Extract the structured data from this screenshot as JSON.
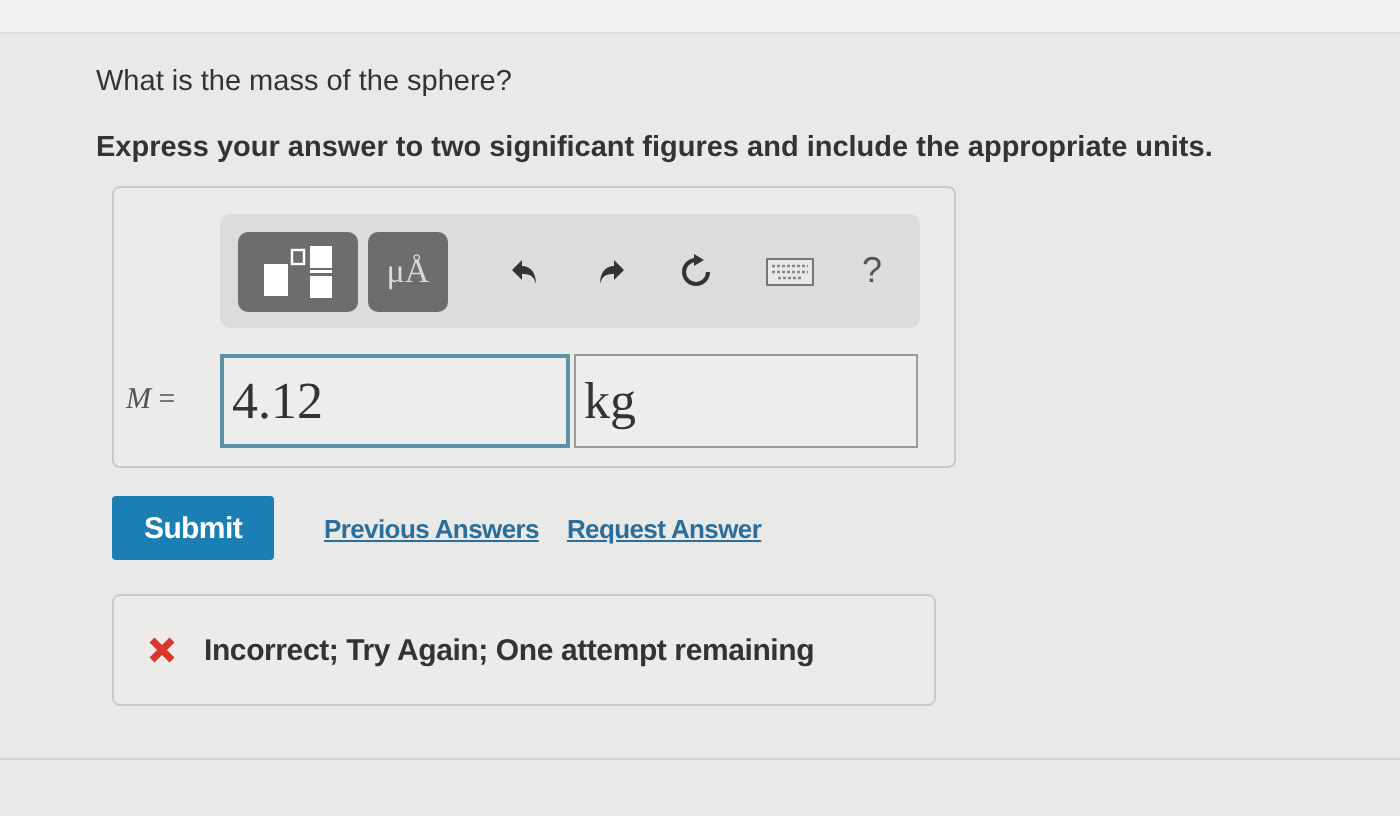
{
  "question": "What is the mass of the sphere?",
  "instruction": "Express your answer to two significant figures and include the appropriate units.",
  "toolbar": {
    "units_button": "μÅ",
    "help": "?"
  },
  "answer": {
    "label": "*M* =",
    "value": "4.12",
    "unit": "kg"
  },
  "submit": "Submit",
  "links": [
    "Previous Answers",
    "Request Answer"
  ],
  "feedback": {
    "kind": "incorrect",
    "message": "Incorrect; Try Again; One attempt remaining"
  }
}
